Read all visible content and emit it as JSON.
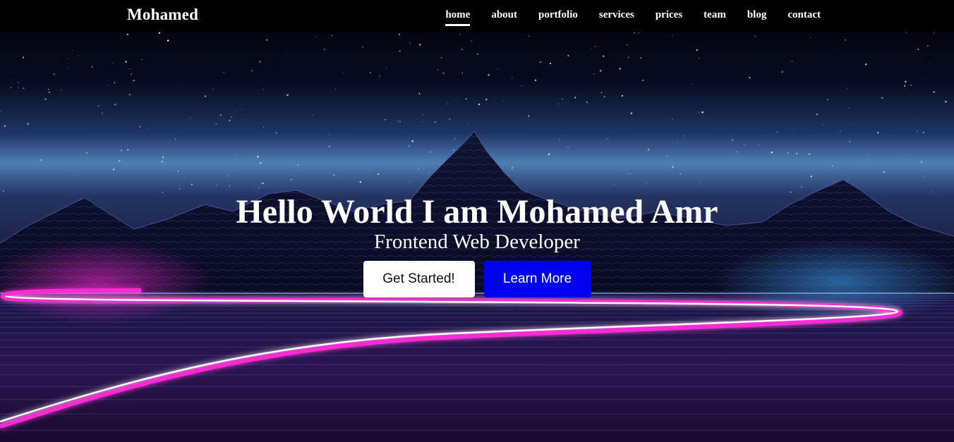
{
  "brand": {
    "name": "Mohamed"
  },
  "nav": {
    "items": [
      "home",
      "about",
      "portfolio",
      "services",
      "prices",
      "team",
      "blog",
      "contact"
    ],
    "active": "home"
  },
  "hero": {
    "title": "Hello World I am Mohamed Amr",
    "subtitle": "Frontend Web Developer",
    "primary_button": "Get Started!",
    "secondary_button": "Learn More"
  },
  "colors": {
    "navbar": "#000000",
    "primary_button_bg": "#ffffff",
    "secondary_button_bg": "#0000f0",
    "neon_magenta": "#ff2bd6",
    "neon_cyan": "#3fd7ff"
  }
}
